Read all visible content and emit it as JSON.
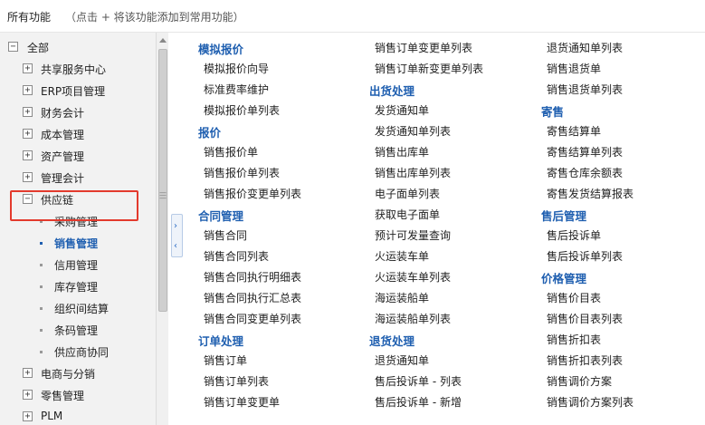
{
  "header": {
    "title": "所有功能",
    "hint": "（点击 + 将该功能添加到常用功能）"
  },
  "sidebar": {
    "root": {
      "label": "全部",
      "toggle": "⊟"
    },
    "items": [
      {
        "label": "共享服务中心",
        "toggle": "⊞"
      },
      {
        "label": "ERP项目管理",
        "toggle": "⊞"
      },
      {
        "label": "财务会计",
        "toggle": "⊞"
      },
      {
        "label": "成本管理",
        "toggle": "⊞"
      },
      {
        "label": "资产管理",
        "toggle": "⊞"
      },
      {
        "label": "管理会计",
        "toggle": "⊞"
      },
      {
        "label": "供应链",
        "toggle": "⊟"
      },
      {
        "label": "采购管理"
      },
      {
        "label": "销售管理"
      },
      {
        "label": "信用管理"
      },
      {
        "label": "库存管理"
      },
      {
        "label": "组织间结算"
      },
      {
        "label": "条码管理"
      },
      {
        "label": "供应商协同"
      },
      {
        "label": "电商与分销",
        "toggle": "⊞"
      },
      {
        "label": "零售管理",
        "toggle": "⊞"
      },
      {
        "label": "PLM",
        "toggle": "⊞"
      }
    ],
    "selected": "销售管理"
  },
  "collapse": {
    "up": "›",
    "down": "‹"
  },
  "columns": [
    [
      {
        "text": "模拟报价",
        "head": true
      },
      {
        "text": "模拟报价向导"
      },
      {
        "text": "标准费率维护"
      },
      {
        "text": "模拟报价单列表"
      },
      {
        "text": "报价",
        "head": true
      },
      {
        "text": "销售报价单"
      },
      {
        "text": "销售报价单列表"
      },
      {
        "text": "销售报价变更单列表"
      },
      {
        "text": "合同管理",
        "head": true
      },
      {
        "text": "销售合同"
      },
      {
        "text": "销售合同列表"
      },
      {
        "text": "销售合同执行明细表"
      },
      {
        "text": "销售合同执行汇总表"
      },
      {
        "text": "销售合同变更单列表"
      },
      {
        "text": "订单处理",
        "head": true
      },
      {
        "text": "销售订单"
      },
      {
        "text": "销售订单列表"
      },
      {
        "text": "销售订单变更单"
      }
    ],
    [
      {
        "text": "销售订单变更单列表"
      },
      {
        "text": "销售订单新变更单列表"
      },
      {
        "text": "出货处理",
        "head": true
      },
      {
        "text": "发货通知单"
      },
      {
        "text": "发货通知单列表"
      },
      {
        "text": "销售出库单"
      },
      {
        "text": "销售出库单列表"
      },
      {
        "text": "电子面单列表"
      },
      {
        "text": "获取电子面单"
      },
      {
        "text": "预计可发量查询"
      },
      {
        "text": "火运装车单"
      },
      {
        "text": "火运装车单列表"
      },
      {
        "text": "海运装船单"
      },
      {
        "text": "海运装船单列表"
      },
      {
        "text": "退货处理",
        "head": true
      },
      {
        "text": "退货通知单"
      },
      {
        "text": "售后投诉单 - 列表"
      },
      {
        "text": "售后投诉单 - 新增"
      }
    ],
    [
      {
        "text": "退货通知单列表"
      },
      {
        "text": "销售退货单"
      },
      {
        "text": "销售退货单列表"
      },
      {
        "text": "寄售",
        "head": true
      },
      {
        "text": "寄售结算单"
      },
      {
        "text": "寄售结算单列表"
      },
      {
        "text": "寄售仓库余额表"
      },
      {
        "text": "寄售发货结算报表"
      },
      {
        "text": "售后管理",
        "head": true
      },
      {
        "text": "售后投诉单"
      },
      {
        "text": "售后投诉单列表"
      },
      {
        "text": "价格管理",
        "head": true
      },
      {
        "text": "销售价目表"
      },
      {
        "text": "销售价目表列表"
      },
      {
        "text": "销售折扣表"
      },
      {
        "text": "销售折扣表列表"
      },
      {
        "text": "销售调价方案"
      },
      {
        "text": "销售调价方案列表"
      }
    ]
  ]
}
